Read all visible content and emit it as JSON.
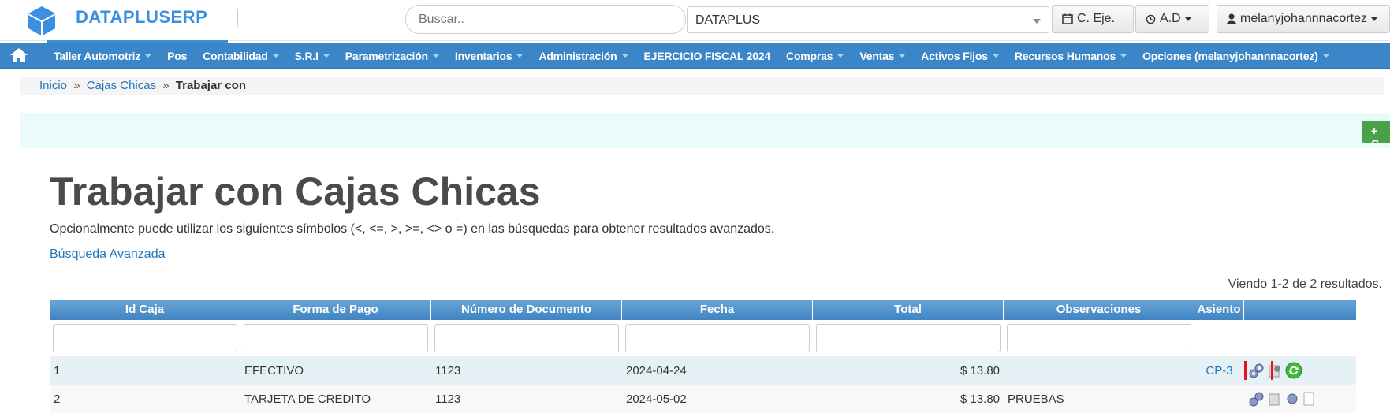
{
  "app": {
    "brand": "DATAPLUSERP"
  },
  "header": {
    "search_placeholder": "Buscar..",
    "company": "DATAPLUS",
    "fiscal_button": "C. Eje.",
    "ad_button": "A.D",
    "user_button": "melanyjohannnacortez"
  },
  "nav": {
    "items": [
      "Taller Automotriz",
      "Pos",
      "Contabilidad",
      "S.R.I",
      "Parametrización",
      "Inventarios",
      "Administración",
      "EJERCICIO FISCAL 2024",
      "Compras",
      "Ventas",
      "Activos Fijos",
      "Recursos Humanos",
      "Opciones (melanyjohannnacortez)"
    ]
  },
  "breadcrumb": {
    "home": "Inicio",
    "section": "Cajas Chicas",
    "current": "Trabajar con"
  },
  "page": {
    "title": "Trabajar con Cajas Chicas",
    "hint": "Opcionalmente puede utilizar los siguientes símbolos (<, <=, >, >=, <> o =) en las búsquedas para obtener resultados avanzados.",
    "advanced_search": "Búsqueda Avanzada",
    "summary": "Viendo 1-2 de 2 resultados.",
    "new_button": "+ C"
  },
  "grid": {
    "columns": [
      "Id Caja",
      "Forma de Pago",
      "Número de Documento",
      "Fecha",
      "Total",
      "Observaciones",
      "Asiento",
      ""
    ],
    "rows": [
      {
        "id": "1",
        "forma": "EFECTIVO",
        "documento": "1123",
        "fecha": "2024-04-24",
        "total": "$ 13.80",
        "obs": "",
        "asiento": "CP-3"
      },
      {
        "id": "2",
        "forma": "TARJETA DE CREDITO",
        "documento": "1123",
        "fecha": "2024-05-02",
        "total": "$ 13.80",
        "obs": "PRUEBAS",
        "asiento": ""
      }
    ]
  },
  "colors": {
    "brand": "#3c8ee1",
    "nav": "#3b86c8",
    "highlight": "#e4131c",
    "new_button": "#49a24a"
  }
}
